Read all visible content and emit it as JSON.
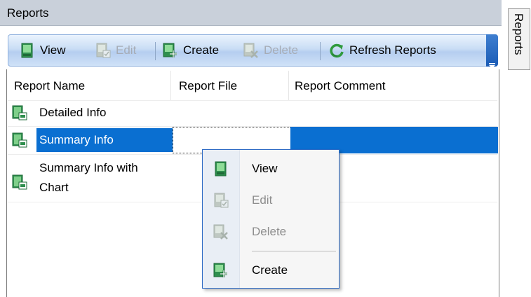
{
  "panel": {
    "title": "Reports"
  },
  "side_tab": {
    "label": "Reports"
  },
  "toolbar": {
    "view": "View",
    "edit": "Edit",
    "create": "Create",
    "delete": "Delete",
    "refresh": "Refresh Reports"
  },
  "columns": [
    "Report Name",
    "Report File",
    "Report Comment"
  ],
  "rows": [
    {
      "name": "Detailed Info",
      "file": "",
      "comment": ""
    },
    {
      "name": "Summary Info",
      "file": "",
      "comment": "",
      "selected": true
    },
    {
      "name_line1": "Summary Info with",
      "name_line2": "Chart",
      "file": "",
      "comment": ""
    }
  ],
  "context_menu": {
    "items": [
      {
        "label": "View",
        "enabled": true,
        "icon": "report-view-icon"
      },
      {
        "label": "Edit",
        "enabled": false,
        "icon": "report-edit-icon"
      },
      {
        "label": "Delete",
        "enabled": false,
        "icon": "report-delete-icon"
      },
      {
        "label": "Create",
        "enabled": true,
        "icon": "report-create-icon"
      }
    ]
  },
  "colors": {
    "selection": "#0a6fd1",
    "toolbar_border": "#8fb0dd",
    "menu_border": "#2d6ac4",
    "icon_green": "#3a9b4a"
  }
}
